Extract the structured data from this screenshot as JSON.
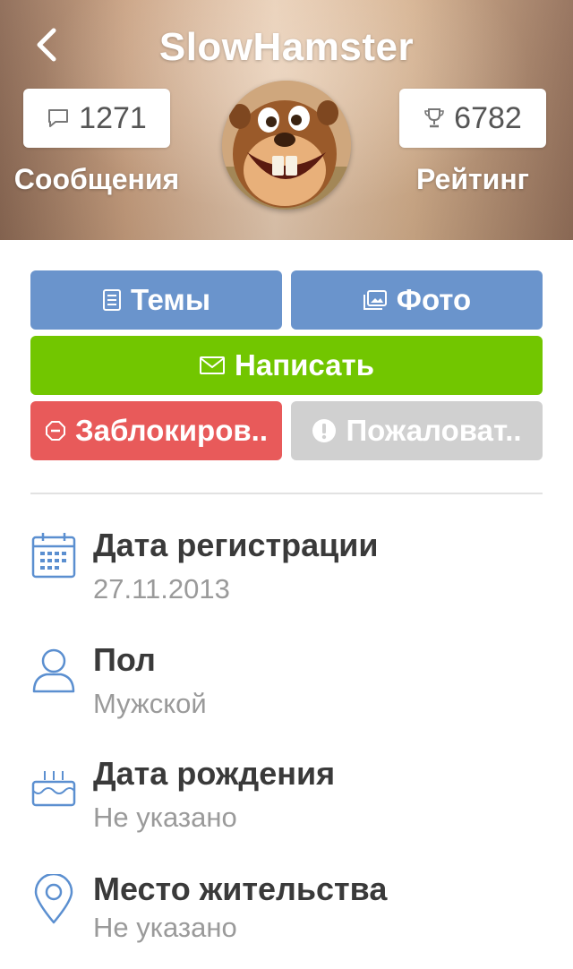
{
  "header": {
    "username": "SlowHamster",
    "messages": {
      "count": "1271",
      "label": "Сообщения",
      "icon": "comment-icon"
    },
    "rating": {
      "count": "6782",
      "label": "Рейтинг",
      "icon": "trophy-icon"
    },
    "avatar": "hamster-avatar"
  },
  "actions": {
    "topics": "Темы",
    "photo": "Фото",
    "write": "Написать",
    "block": "Заблокиров..",
    "report": "Пожаловат.."
  },
  "info": [
    {
      "label": "Дата регистрации",
      "value": "27.11.2013",
      "icon": "calendar-icon"
    },
    {
      "label": "Пол",
      "value": "Мужской",
      "icon": "user-icon"
    },
    {
      "label": "Дата рождения",
      "value": "Не указано",
      "icon": "cake-icon"
    },
    {
      "label": "Место жительства",
      "value": "Не указано",
      "icon": "location-pin-icon"
    }
  ],
  "colors": {
    "primary_blue": "#6a94cc",
    "write_green": "#72c600",
    "block_red": "#e85a5a",
    "report_gray": "#d0d0d0",
    "icon_blue": "#5b8fd0"
  }
}
